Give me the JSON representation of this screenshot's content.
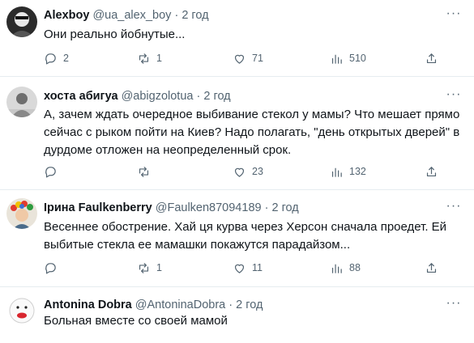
{
  "tweets": [
    {
      "name": "Alexboy",
      "handle": "@ua_alex_boy",
      "separator": "·",
      "time": "2 год",
      "text": "Они реально йобнутые...",
      "avatar_icon": "dark-avatar",
      "replies": "2",
      "retweets": "1",
      "likes": "71",
      "views": "510"
    },
    {
      "name": "хоста абигуа",
      "handle": "@abigzolotua",
      "separator": "·",
      "time": "2 год",
      "text": "А, зачем ждать очередное выбивание стекол у мамы? Что мешает прямо сейчас с рыком пойти на Киев? Надо полагать, \"день открытых дверей\" в дурдоме отложен на неопределенный срок.",
      "avatar_icon": "person-avatar",
      "replies": "",
      "retweets": "",
      "likes": "23",
      "views": "132"
    },
    {
      "name": "Ірина Faulkenberry",
      "handle": "@Faulken87094189",
      "separator": "·",
      "time": "2 год",
      "text": "Весеннее обострение. Хай ця курва через Херсон сначала проедет. Ей выбитые стекла ее мамашки покажутся парадайзом...",
      "avatar_icon": "flower-wreath-avatar",
      "replies": "",
      "retweets": "1",
      "likes": "11",
      "views": "88"
    },
    {
      "name": "Antonina Dobra",
      "handle": "@AntoninaDobra",
      "separator": "·",
      "time": "2 год",
      "text": "Больная вместе со своей мамой",
      "avatar_icon": "cartoon-face-avatar"
    }
  ],
  "icons": {
    "reply": "reply-icon",
    "retweet": "retweet-icon",
    "like": "heart-icon",
    "views": "views-chart-icon",
    "share": "share-icon",
    "more": "more-dots-icon"
  },
  "colors": {
    "text": "#0f1419",
    "secondary": "#536471",
    "divider": "#e6ecf0"
  }
}
